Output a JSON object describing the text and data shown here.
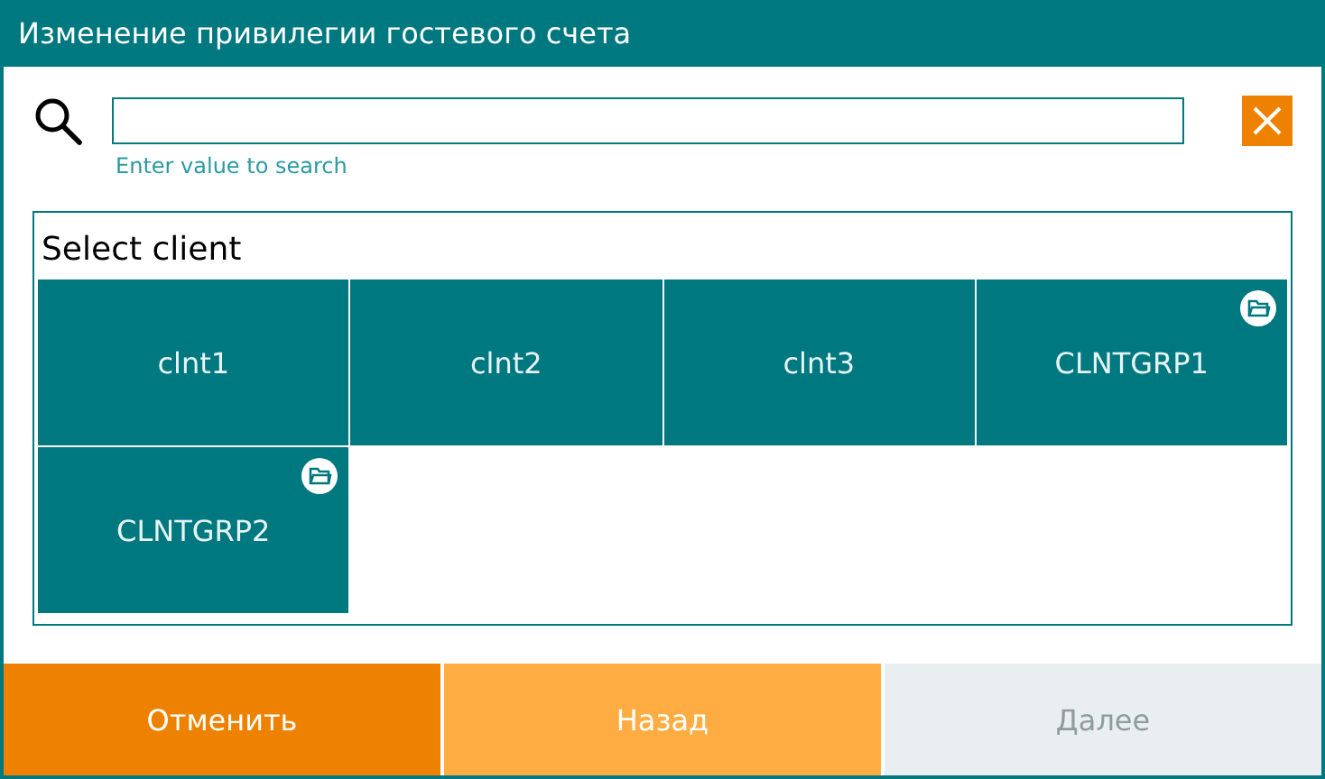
{
  "window": {
    "title": "Изменение привилегии гостевого счета"
  },
  "search": {
    "hint": "Enter value to search"
  },
  "panel": {
    "title": "Select client",
    "tiles": [
      {
        "label": "clnt1",
        "kind": "client"
      },
      {
        "label": "clnt2",
        "kind": "client"
      },
      {
        "label": "clnt3",
        "kind": "client"
      },
      {
        "label": "CLNTGRP1",
        "kind": "group"
      },
      {
        "label": "CLNTGRP2",
        "kind": "group"
      }
    ]
  },
  "buttons": [
    {
      "label": "Отменить",
      "kind": "cancel",
      "disabled": false
    },
    {
      "label": "Назад",
      "kind": "back",
      "disabled": false
    },
    {
      "label": "Далее",
      "kind": "next",
      "disabled": true
    }
  ]
}
